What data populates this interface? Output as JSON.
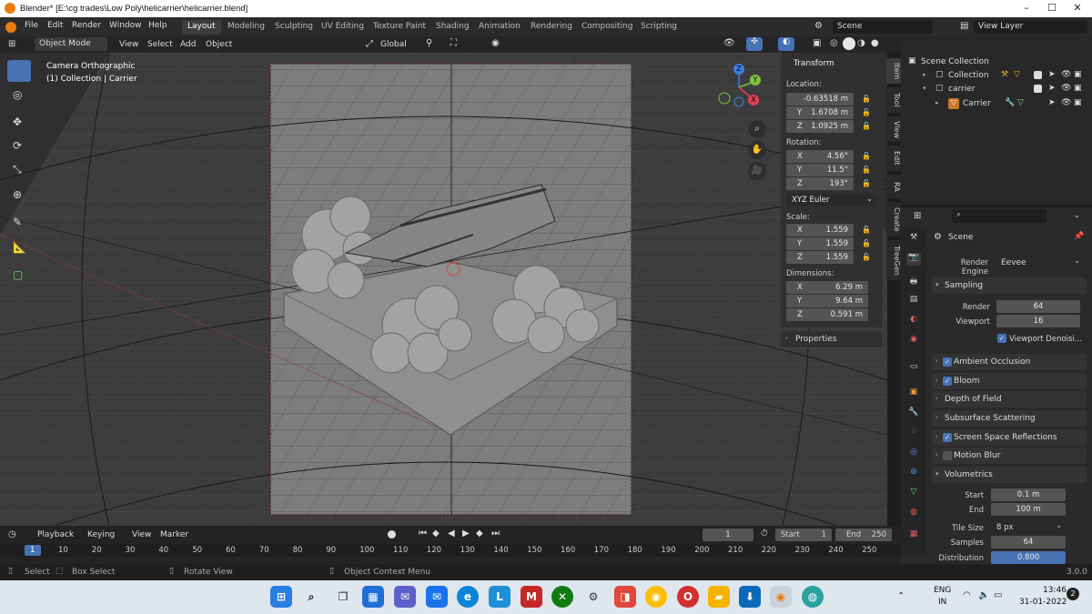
{
  "window": {
    "title": "Blender* [E:\\cg trades\\Low Poly\\helicarrier\\helicarrier.blend]",
    "minimize": "–",
    "maximize": "☐",
    "close": "✕"
  },
  "menu": [
    "File",
    "Edit",
    "Render",
    "Window",
    "Help"
  ],
  "workspaces": [
    "Layout",
    "Modeling",
    "Sculpting",
    "UV Editing",
    "Texture Paint",
    "Shading",
    "Animation",
    "Rendering",
    "Compositing",
    "Scripting"
  ],
  "scene_field": "Scene",
  "view_layer_field": "View Layer",
  "viewport_header": {
    "mode": "Object Mode",
    "menus": [
      "View",
      "Select",
      "Add",
      "Object"
    ],
    "transform_orientation": "Global"
  },
  "viewport": {
    "overlay_line1": "Camera Orthographic",
    "overlay_line2": "(1) Collection | Carrier",
    "gizmo_x": "X",
    "gizmo_y": "Y",
    "gizmo_z": "Z"
  },
  "npanel": {
    "header": "Transform",
    "location_label": "Location:",
    "location": [
      "-0.63518 m",
      "1.6708 m",
      "1.0925 m"
    ],
    "rotation_label": "Rotation:",
    "rotation": [
      "4.56°",
      "11.5°",
      "193°"
    ],
    "rotation_mode": "XYZ Euler",
    "scale_label": "Scale:",
    "scale": [
      "1.559",
      "1.559",
      "1.559"
    ],
    "dimensions_label": "Dimensions:",
    "dimensions": [
      "6.29 m",
      "9.64 m",
      "0.591 m"
    ],
    "axes": [
      "X",
      "Y",
      "Z"
    ],
    "properties": "Properties"
  },
  "side_tabs": [
    "Item",
    "Tool",
    "View",
    "Edit",
    "RA",
    "Create",
    "TreeGen"
  ],
  "outliner": {
    "rows": [
      {
        "label": "Scene Collection",
        "indent": 0
      },
      {
        "label": "Collection",
        "indent": 1
      },
      {
        "label": "carrier",
        "indent": 1
      },
      {
        "label": "Carrier",
        "indent": 2
      }
    ]
  },
  "properties": {
    "context": "Scene",
    "render_engine_label": "Render Engine",
    "render_engine": "Eevee",
    "sampling": "Sampling",
    "render_label": "Render",
    "render_value": "64",
    "viewport_label": "Viewport",
    "viewport_value": "16",
    "viewport_denoise": "Viewport Denoisi...",
    "sections": [
      {
        "label": "Ambient Occlusion",
        "checked": true
      },
      {
        "label": "Bloom",
        "checked": true
      },
      {
        "label": "Depth of Field",
        "checked": null
      },
      {
        "label": "Subsurface Scattering",
        "checked": null
      },
      {
        "label": "Screen Space Reflections",
        "checked": true
      },
      {
        "label": "Motion Blur",
        "checked": false
      }
    ],
    "volumetrics": "Volumetrics",
    "start_label": "Start",
    "start_value": "0.1 m",
    "end_label": "End",
    "end_value": "100 m",
    "tile_label": "Tile Size",
    "tile_value": "8 px",
    "samples_label": "Samples",
    "samples_value": "64",
    "distribution_label": "Distribution",
    "distribution_value": "0.800"
  },
  "timeline": {
    "menus": [
      "Playback",
      "Keying",
      "View",
      "Marker"
    ],
    "current_frame": "1",
    "start_label": "Start",
    "start_value": "1",
    "end_label": "End",
    "end_value": "250",
    "ticks": [
      "1",
      "10",
      "20",
      "30",
      "40",
      "50",
      "60",
      "70",
      "80",
      "90",
      "100",
      "110",
      "120",
      "130",
      "140",
      "150",
      "160",
      "170",
      "180",
      "190",
      "200",
      "210",
      "220",
      "230",
      "240",
      "250"
    ]
  },
  "status": {
    "select": "Select",
    "box_select": "Box Select",
    "rotate_view": "Rotate View",
    "context_menu": "Object Context Menu",
    "version": "3.0.0"
  },
  "taskbar": {
    "lang1": "ENG",
    "lang2": "IN",
    "time": "13:46",
    "date": "31-01-2022"
  }
}
